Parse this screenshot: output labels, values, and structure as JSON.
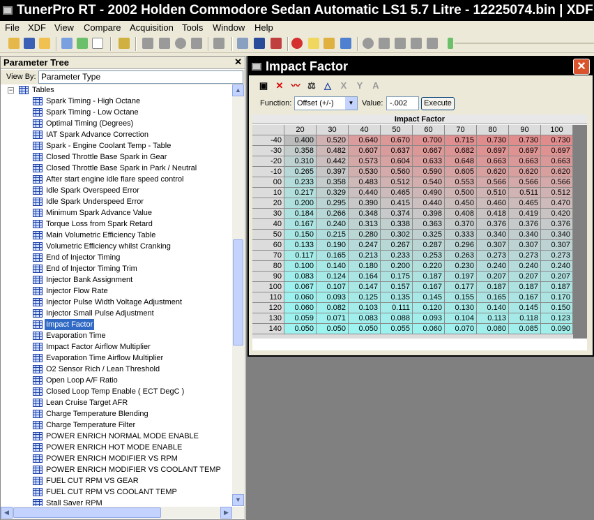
{
  "app_title": "TunerPro RT - 2002 Holden Commodore Sedan Automatic LS1 5.7 Litre - 12225074.bin | XDF",
  "menu": [
    "File",
    "XDF",
    "View",
    "Compare",
    "Acquisition",
    "Tools",
    "Window",
    "Help"
  ],
  "toolbar_icons": [
    "open-icon",
    "save-icon",
    "open-folder-icon",
    "load-xdf-icon",
    "recycle-icon",
    "new-doc-icon",
    "probe-icon",
    "up-arrow-icon",
    "down-arrow-icon",
    "circle-icon",
    "copy-icon",
    "chip-icon",
    "settings-icon",
    "swap-icon",
    "emulator-icon",
    "gauge-icon",
    "notes-icon",
    "chip-reader-icon",
    "chart-icon",
    "record-icon",
    "play-icon",
    "pause-icon",
    "stop-icon",
    "eject-icon",
    "slider-icon"
  ],
  "left_panel": {
    "title": "Parameter Tree",
    "close": "✕",
    "view_by_label": "View By:",
    "view_by_value": "Parameter Type",
    "root": "Tables",
    "items": [
      "Spark Timing - High Octane",
      "Spark Timing - Low Octane",
      "Optimal Timing (Degrees)",
      "IAT Spark Advance Correction",
      "Spark - Engine Coolant Temp - Table",
      "Closed Throttle Base Spark in Gear",
      "Closed Throttle Base Spark in Park / Neutral",
      "After start engine idle flare speed control",
      "Idle Spark Overspeed Error",
      "Idle Spark Underspeed Error",
      "Minimum Spark Advance Value",
      "Torque Loss from Spark Retard",
      "Main Volumetric Efficiency Table",
      "Volumetric Efficiency whilst Cranking",
      "End of Injector Timing",
      "End of Injector Timing Trim",
      "Injector Bank Assignment",
      "Injector Flow Rate",
      "Injector Pulse Width Voltage Adjustment",
      "Injector Small Pulse Adjustment",
      "Impact Factor",
      "Evaporation Time",
      "Impact Factor Airflow Multiplier",
      "Evaporation Time Airflow Multiplier",
      "O2 Sensor Rich /  Lean Threshold",
      "Open Loop A/F Ratio",
      "Closed Loop Temp Enable ( ECT DegC )",
      "Lean Cruise Target AFR",
      "Charge Temperature Blending",
      "Charge Temperature Filter",
      "POWER ENRICH NORMAL MODE ENABLE",
      "POWER ENRICH HOT MODE ENABLE",
      "POWER ENRICH MODIFIER VS RPM",
      "POWER ENRICH MODIFIER VS COOLANT TEMP",
      "FUEL CUT RPM VS GEAR",
      "FUEL CUT RPM VS COOLANT TEMP",
      "Stall Saver RPM"
    ],
    "selected_index": 20
  },
  "table_window": {
    "title": "Impact Factor",
    "function_label": "Function:",
    "function_value": "Offset (+/-)",
    "value_label": "Value:",
    "value_input": "-.002",
    "execute_label": "Execute",
    "grid_title": "Impact Factor",
    "columns": [
      "20",
      "30",
      "40",
      "50",
      "60",
      "70",
      "80",
      "90",
      "100"
    ],
    "rows": [
      {
        "label": "-40",
        "values": [
          "0.400",
          "0.520",
          "0.640",
          "0.670",
          "0.700",
          "0.715",
          "0.730",
          "0.730",
          "0.730"
        ]
      },
      {
        "label": "-30",
        "values": [
          "0.358",
          "0.482",
          "0.607",
          "0.637",
          "0.667",
          "0.682",
          "0.697",
          "0.697",
          "0.697"
        ]
      },
      {
        "label": "-20",
        "values": [
          "0.310",
          "0.442",
          "0.573",
          "0.604",
          "0.633",
          "0.648",
          "0.663",
          "0.663",
          "0.663"
        ]
      },
      {
        "label": "-10",
        "values": [
          "0.265",
          "0.397",
          "0.530",
          "0.560",
          "0.590",
          "0.605",
          "0.620",
          "0.620",
          "0.620"
        ]
      },
      {
        "label": "00",
        "values": [
          "0.233",
          "0.358",
          "0.483",
          "0.512",
          "0.540",
          "0.553",
          "0.566",
          "0.566",
          "0.566"
        ]
      },
      {
        "label": "10",
        "values": [
          "0.217",
          "0.329",
          "0.440",
          "0.465",
          "0.490",
          "0.500",
          "0.510",
          "0.511",
          "0.512"
        ]
      },
      {
        "label": "20",
        "values": [
          "0.200",
          "0.295",
          "0.390",
          "0.415",
          "0.440",
          "0.450",
          "0.460",
          "0.465",
          "0.470"
        ]
      },
      {
        "label": "30",
        "values": [
          "0.184",
          "0.266",
          "0.348",
          "0.374",
          "0.398",
          "0.408",
          "0.418",
          "0.419",
          "0.420"
        ]
      },
      {
        "label": "40",
        "values": [
          "0.167",
          "0.240",
          "0.313",
          "0.338",
          "0.363",
          "0.370",
          "0.376",
          "0.376",
          "0.376"
        ]
      },
      {
        "label": "50",
        "values": [
          "0.150",
          "0.215",
          "0.280",
          "0.302",
          "0.325",
          "0.333",
          "0.340",
          "0.340",
          "0.340"
        ]
      },
      {
        "label": "60",
        "values": [
          "0.133",
          "0.190",
          "0.247",
          "0.267",
          "0.287",
          "0.296",
          "0.307",
          "0.307",
          "0.307"
        ]
      },
      {
        "label": "70",
        "values": [
          "0.117",
          "0.165",
          "0.213",
          "0.233",
          "0.253",
          "0.263",
          "0.273",
          "0.273",
          "0.273"
        ]
      },
      {
        "label": "80",
        "values": [
          "0.100",
          "0.140",
          "0.180",
          "0.200",
          "0.220",
          "0.230",
          "0.240",
          "0.240",
          "0.240"
        ]
      },
      {
        "label": "90",
        "values": [
          "0.083",
          "0.124",
          "0.164",
          "0.175",
          "0.187",
          "0.197",
          "0.207",
          "0.207",
          "0.207"
        ]
      },
      {
        "label": "100",
        "values": [
          "0.067",
          "0.107",
          "0.147",
          "0.157",
          "0.167",
          "0.177",
          "0.187",
          "0.187",
          "0.187"
        ]
      },
      {
        "label": "110",
        "values": [
          "0.060",
          "0.093",
          "0.125",
          "0.135",
          "0.145",
          "0.155",
          "0.165",
          "0.167",
          "0.170"
        ]
      },
      {
        "label": "120",
        "values": [
          "0.060",
          "0.082",
          "0.103",
          "0.111",
          "0.120",
          "0.130",
          "0.140",
          "0.145",
          "0.150"
        ]
      },
      {
        "label": "130",
        "values": [
          "0.059",
          "0.071",
          "0.083",
          "0.088",
          "0.093",
          "0.104",
          "0.113",
          "0.118",
          "0.123"
        ]
      },
      {
        "label": "140",
        "values": [
          "0.050",
          "0.050",
          "0.050",
          "0.055",
          "0.060",
          "0.070",
          "0.080",
          "0.085",
          "0.090"
        ]
      }
    ]
  },
  "colors": {
    "low": "#9cf3f0",
    "mid": "#c8c8c8",
    "high": "#e08c8c",
    "selected_tree": "#316ac5",
    "window_close": "#d9532c"
  }
}
